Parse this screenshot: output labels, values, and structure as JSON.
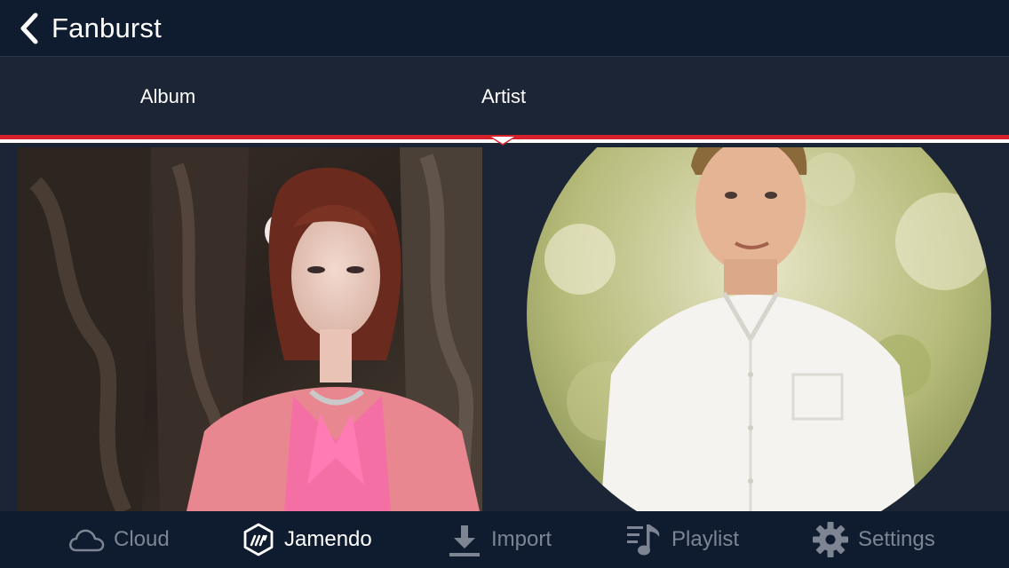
{
  "header": {
    "back_label": "Fanburst"
  },
  "tabs": [
    {
      "label": "Album"
    },
    {
      "label": "Artist"
    }
  ],
  "bottom_nav": [
    {
      "label": "Cloud",
      "icon": "cloud-icon"
    },
    {
      "label": "Jamendo",
      "icon": "jamendo-icon"
    },
    {
      "label": "Import",
      "icon": "download-icon"
    },
    {
      "label": "Playlist",
      "icon": "playlist-icon"
    },
    {
      "label": "Settings",
      "icon": "gear-icon"
    }
  ],
  "colors": {
    "header_bg": "#0f1c30",
    "tab_bg": "#1c2535",
    "indicator_red": "#d6202b",
    "active_label": "#ffffff",
    "inactive_label": "#7d8593"
  }
}
